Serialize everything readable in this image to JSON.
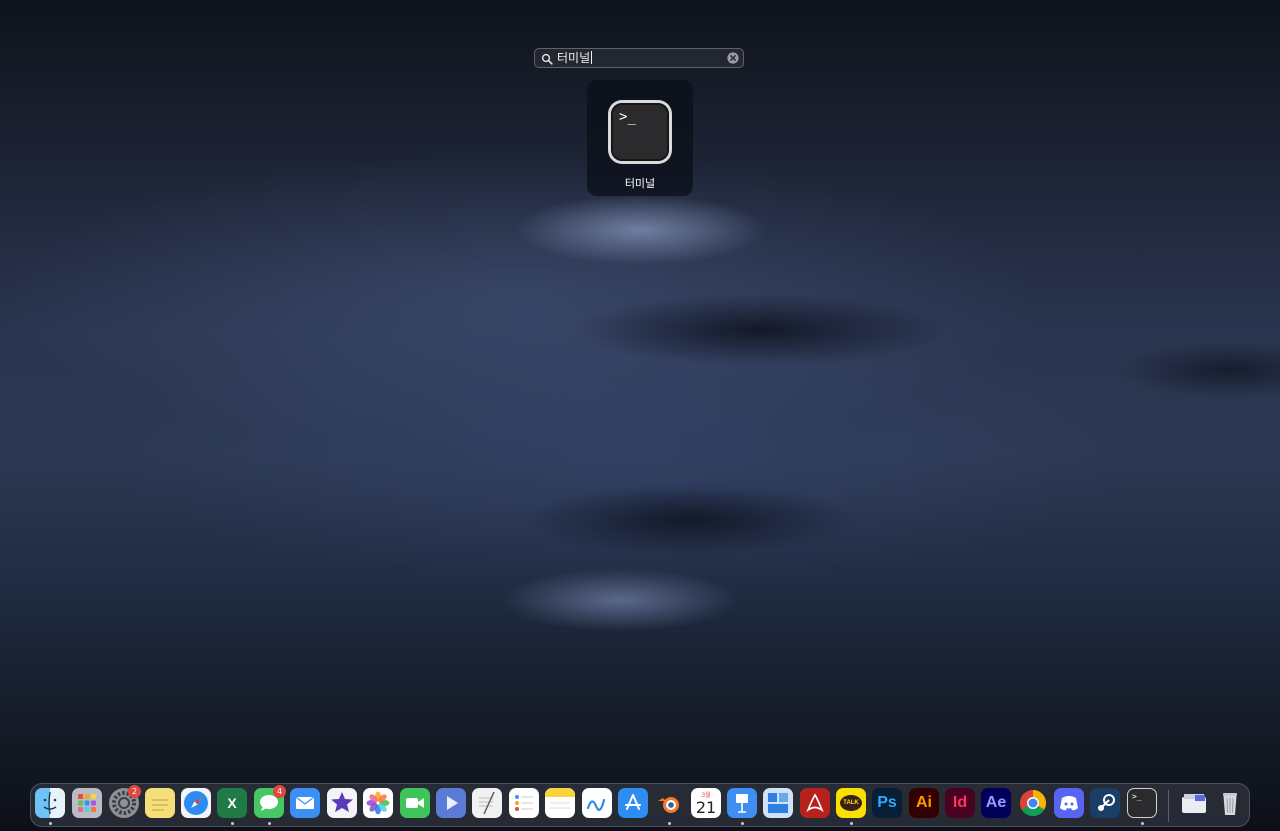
{
  "search": {
    "query": "터미널"
  },
  "result": {
    "label": "터미널",
    "prompt": ">_"
  },
  "dock": {
    "badges": {
      "settings": "2",
      "messages": "4"
    },
    "calendar": {
      "month": "3월",
      "day": "21"
    },
    "excel_letter": "X",
    "kakao_text": "TALK",
    "ps_text": "Ps",
    "ai_text": "Ai",
    "id_text": "Id",
    "ae_text": "Ae",
    "terminal_prompt": ">_"
  },
  "colors": {
    "badge": "#e2463c",
    "dock": "#30343e"
  }
}
